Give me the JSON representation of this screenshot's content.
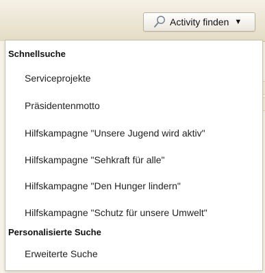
{
  "button": {
    "label": "Activity finden",
    "icon": "search-icon",
    "caret": "chevron-down-icon"
  },
  "quick_search": {
    "heading": "Schnellsuche",
    "items": [
      "Serviceprojekte",
      "Präsidentenmotto",
      "Hilfskampagne \"Unsere Jugend wird aktiv\"",
      "Hilfskampagne \"Sehkraft für alle\"",
      "Hilfskampagne \"Den Hunger lindern\"",
      "Hilfskampagne \"Schutz für unsere Umwelt\""
    ]
  },
  "personal_search": {
    "heading": "Personalisierte Suche",
    "items": [
      "Erweiterte Suche"
    ]
  },
  "colors": {
    "header_bg": "#e3dcc4",
    "panel_border": "#c9c2ae",
    "text": "#222222"
  }
}
